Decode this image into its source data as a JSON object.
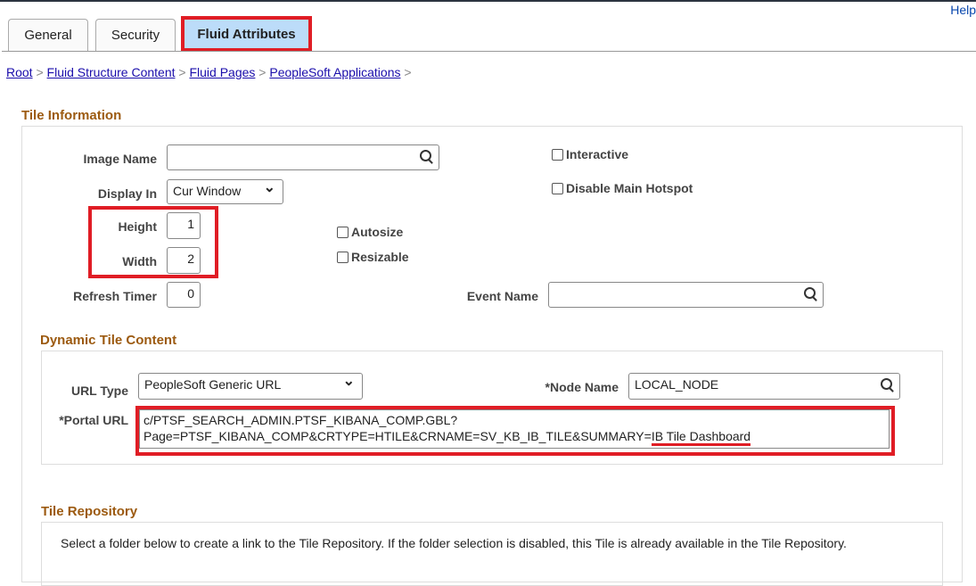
{
  "help": "Help",
  "tabs": [
    "General",
    "Security",
    "Fluid Attributes"
  ],
  "breadcrumb": [
    "Root",
    "Fluid Structure Content",
    "Fluid Pages",
    "PeopleSoft Applications"
  ],
  "tile_info": {
    "title": "Tile Information",
    "image_name_label": "Image Name",
    "image_name": "",
    "display_in_label": "Display In",
    "display_in": "Cur Window",
    "height_label": "Height",
    "height": "1",
    "width_label": "Width",
    "width": "2",
    "refresh_label": "Refresh Timer",
    "refresh": "0",
    "interactive": "Interactive",
    "disable_hotspot": "Disable Main Hotspot",
    "autosize": "Autosize",
    "resizable": "Resizable",
    "event_name_label": "Event Name",
    "event_name": ""
  },
  "dynamic": {
    "title": "Dynamic Tile Content",
    "url_type_label": "URL Type",
    "url_type": "PeopleSoft Generic URL",
    "node_name_label": "*Node Name",
    "node_name": "LOCAL_NODE",
    "portal_url_label": "*Portal URL",
    "portal_url_line1": "c/PTSF_SEARCH_ADMIN.PTSF_KIBANA_COMP.GBL?",
    "portal_url_line2": "Page=PTSF_KIBANA_COMP&CRTYPE=HTILE&CRNAME=SV_KB_IB_TILE&SUMMARY=",
    "portal_url_highlight": "IB Tile Dashboard"
  },
  "repo": {
    "title": "Tile Repository",
    "text": "Select a folder below to create a link to the Tile Repository. If the folder selection is disabled, this Tile is already available in the Tile Repository."
  }
}
